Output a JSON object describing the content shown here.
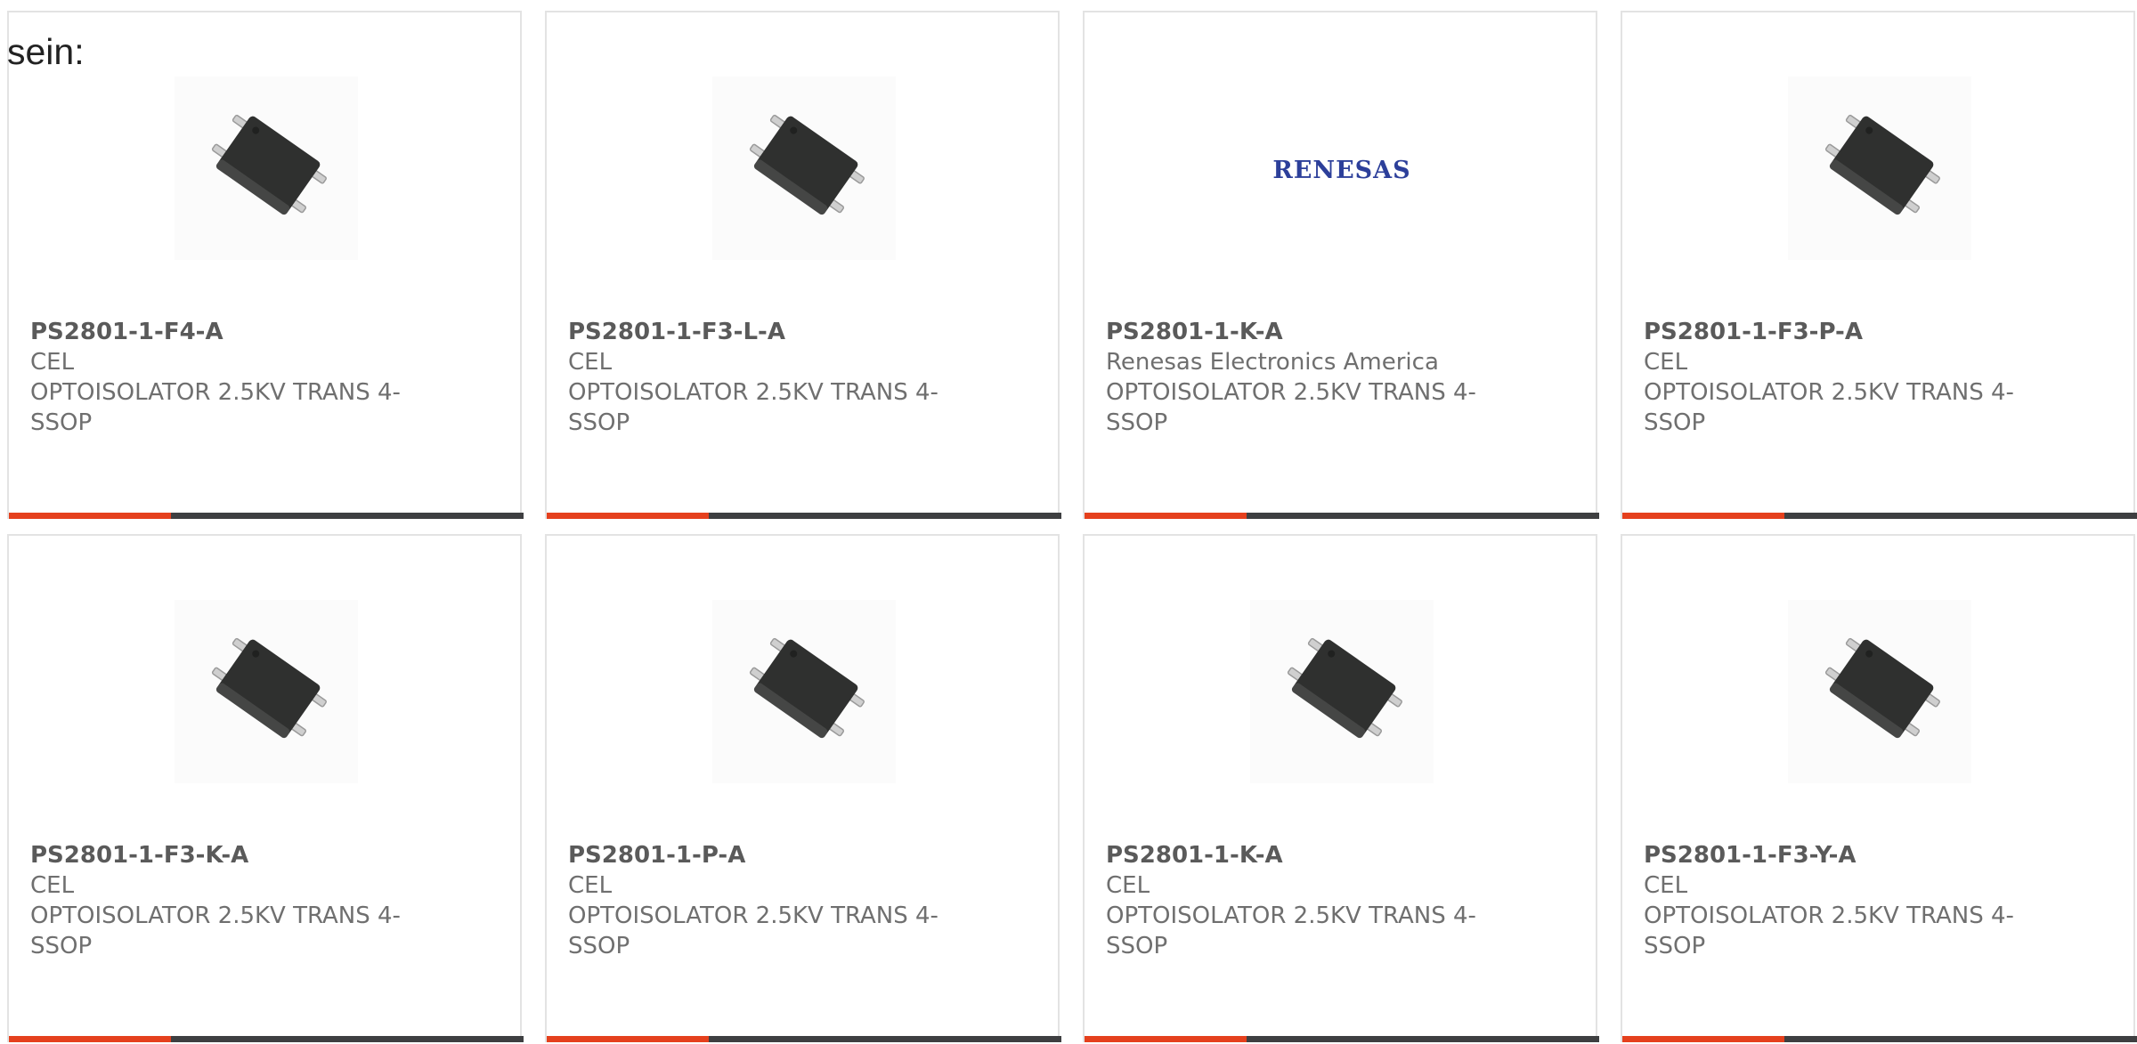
{
  "prefix_text": "sein:",
  "colors": {
    "accent": "#e5401d",
    "bar_dark": "#3e3f41",
    "renesas_blue": "#2c3f9a"
  },
  "cards": [
    {
      "part": "PS2801-1-F4-A",
      "maker": "CEL",
      "desc": "OPTOISOLATOR 2.5KV TRANS 4-SSOP",
      "image": "ssop-chip-image"
    },
    {
      "part": "PS2801-1-F3-L-A",
      "maker": "CEL",
      "desc": "OPTOISOLATOR 2.5KV TRANS 4-SSOP",
      "image": "ssop-chip-image"
    },
    {
      "part": "PS2801-1-K-A",
      "maker": "Renesas Electronics America",
      "desc": "OPTOISOLATOR 2.5KV TRANS 4-SSOP",
      "image": "renesas-logo",
      "logo_text": "RENESAS"
    },
    {
      "part": "PS2801-1-F3-P-A",
      "maker": "CEL",
      "desc": "OPTOISOLATOR 2.5KV TRANS 4-SSOP",
      "image": "ssop-chip-image"
    },
    {
      "part": "PS2801-1-F3-K-A",
      "maker": "CEL",
      "desc": "OPTOISOLATOR 2.5KV TRANS 4-SSOP",
      "image": "ssop-chip-image"
    },
    {
      "part": "PS2801-1-P-A",
      "maker": "CEL",
      "desc": "OPTOISOLATOR 2.5KV TRANS 4-SSOP",
      "image": "ssop-chip-image"
    },
    {
      "part": "PS2801-1-K-A",
      "maker": "CEL",
      "desc": "OPTOISOLATOR 2.5KV TRANS 4-SSOP",
      "image": "ssop-chip-image"
    },
    {
      "part": "PS2801-1-F3-Y-A",
      "maker": "CEL",
      "desc": "OPTOISOLATOR 2.5KV TRANS 4-SSOP",
      "image": "ssop-chip-image"
    }
  ]
}
